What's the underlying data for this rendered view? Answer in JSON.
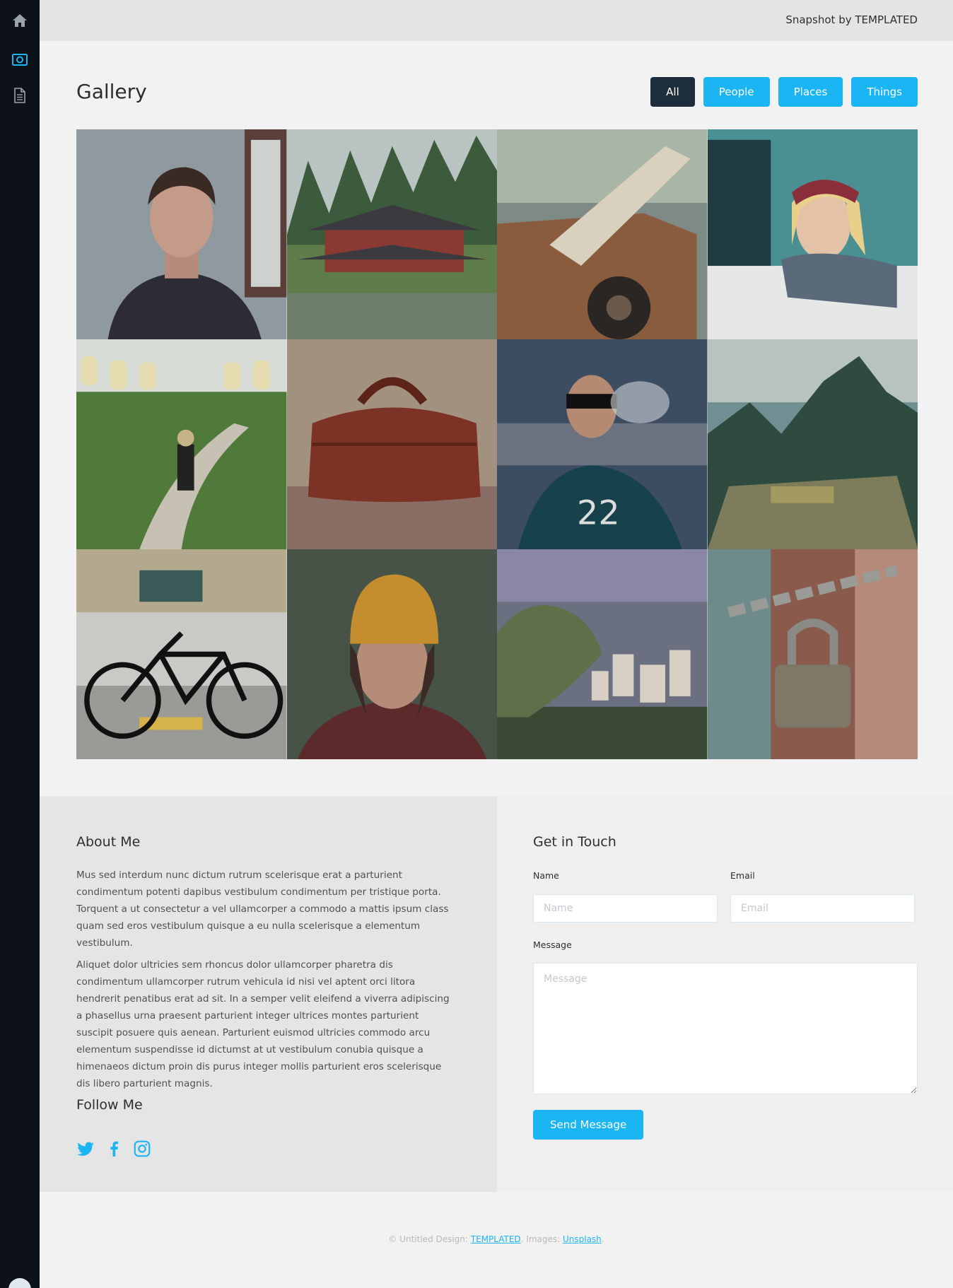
{
  "header": {
    "brand": "Snapshot by TEMPLATED"
  },
  "sidebar": {
    "items": [
      {
        "icon": "home-icon"
      },
      {
        "icon": "camera-icon",
        "active": true
      },
      {
        "icon": "document-icon"
      }
    ],
    "active_color": "#1cb5f4"
  },
  "gallery": {
    "title": "Gallery",
    "filters": [
      "All",
      "People",
      "Places",
      "Things"
    ],
    "active_filter": "All",
    "images": [
      "portrait-man",
      "japanese-temple",
      "rusty-truck-surfboard",
      "woman-in-car",
      "lantern-path",
      "leather-bag",
      "smoking-man",
      "mountain-ruins",
      "bicycle-street",
      "woman-yellow-beanie",
      "gargoyle-city",
      "padlock-chain"
    ]
  },
  "about": {
    "title": "About Me",
    "p1": "Mus sed interdum nunc dictum rutrum scelerisque erat a parturient condimentum potenti dapibus vestibulum condimentum per tristique porta. Torquent a ut consectetur a vel ullamcorper a commodo a mattis ipsum class quam sed eros vestibulum quisque a eu nulla scelerisque a elementum vestibulum.",
    "p2": "Aliquet dolor ultricies sem rhoncus dolor ullamcorper pharetra dis condimentum ullamcorper rutrum vehicula id nisi vel aptent orci litora hendrerit penatibus erat ad sit. In a semper velit eleifend a viverra adipiscing a phasellus urna praesent parturient integer ultrices montes parturient suscipit posuere quis aenean. Parturient euismod ultricies commodo arcu elementum suspendisse id dictumst at ut vestibulum conubia quisque a himenaeos dictum proin dis purus integer mollis parturient eros scelerisque dis libero parturient magnis.",
    "follow_title": "Follow Me",
    "social": [
      "twitter-icon",
      "facebook-icon",
      "instagram-icon"
    ]
  },
  "contact": {
    "title": "Get in Touch",
    "name_label": "Name",
    "name_placeholder": "Name",
    "email_label": "Email",
    "email_placeholder": "Email",
    "message_label": "Message",
    "message_placeholder": "Message",
    "send_label": "Send Message"
  },
  "footer": {
    "prefix": "© Untitled Design: ",
    "templated": "TEMPLATED",
    "images_text": ". Images: ",
    "unsplash": "Unsplash",
    "suffix": "."
  },
  "colors": {
    "accent": "#1cb5f4",
    "dark_button": "#1d2d3b",
    "sidebar": "#0c1217"
  }
}
